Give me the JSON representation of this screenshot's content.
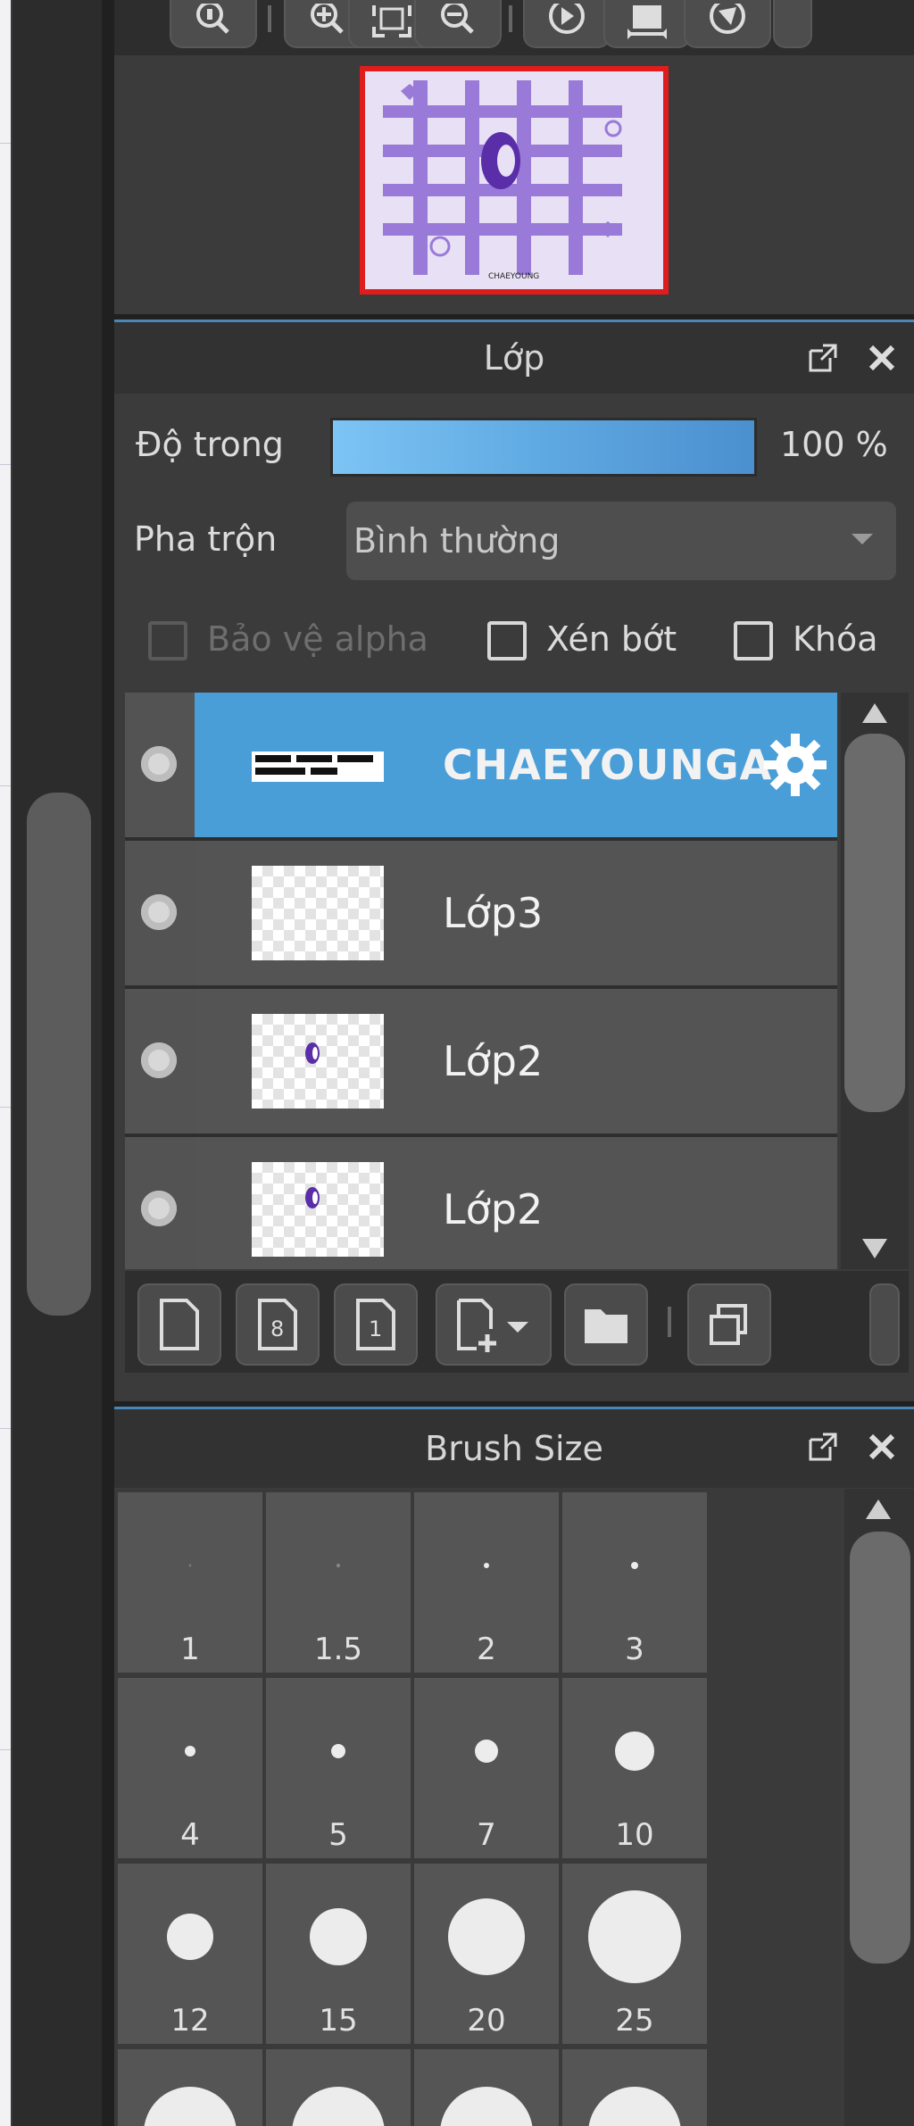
{
  "navigator": {
    "buttons": [
      "zoom-reset-icon",
      "zoom-in-icon",
      "fit-screen-icon",
      "zoom-out-icon",
      "rotate-left-icon",
      "flip-icon",
      "rotate-right-icon"
    ],
    "preview_label": "CHAEYOUNG"
  },
  "layer_panel": {
    "title": "Lớp",
    "opacity_label": "Độ trong",
    "opacity_value": "100 %",
    "blend_label": "Pha trộn",
    "blend_value": "Bình thường",
    "protect_alpha_label": "Bảo vệ alpha",
    "clip_label": "Xén bớt",
    "lock_label": "Khóa",
    "layers": [
      {
        "name": "CHAEYOUNGA",
        "selected": true
      },
      {
        "name": "Lớp3",
        "selected": false
      },
      {
        "name": "Lớp2",
        "selected": false
      },
      {
        "name": "Lớp2",
        "selected": false
      }
    ],
    "toolbar": {
      "duplicate_count": "8",
      "single_count": "1"
    }
  },
  "brush_panel": {
    "title": "Brush Size",
    "sizes": [
      "1",
      "1.5",
      "2",
      "3",
      "4",
      "5",
      "7",
      "10",
      "12",
      "15",
      "20",
      "25"
    ]
  },
  "colors": {
    "accent": "#4a9ed8",
    "preview_border": "#e01c1c",
    "panel_bg": "#3b3b3b"
  }
}
